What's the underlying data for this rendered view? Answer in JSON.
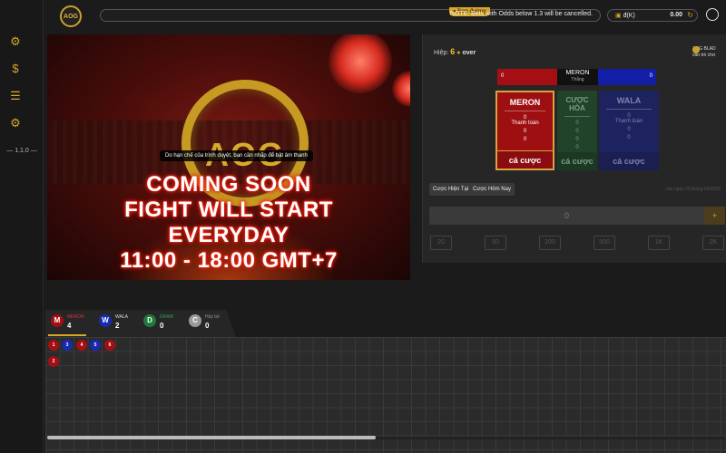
{
  "app": {
    "logo": "AOG",
    "version": "1.1.0"
  },
  "sidebar": {
    "icons": [
      "document-gear-icon",
      "document-money-icon",
      "document-list-icon",
      "gear-icon"
    ]
  },
  "topbar": {
    "pin_label": "Đơn đường",
    "notice": "NOTE: Bets with Odds below 1.3 will be cancelled."
  },
  "balance": {
    "label": "đ(K)",
    "value": "0.00"
  },
  "video": {
    "ring_text": "AOG",
    "tip": "Do hạn chế của trình duyệt, bạn cần nhấp để bật âm thanh",
    "lines": [
      "COMING SOON",
      "FIGHT WILL START",
      "EVERYDAY",
      "11:00 - 18:00 GMT+7"
    ]
  },
  "bet": {
    "round_label": "Hiệp:",
    "round_number": "6",
    "round_status": "over",
    "promo_line1": "AOG BLAD",
    "promo_line2": "vào trò chơ",
    "odds": {
      "meron": "0",
      "center_title": "MERON",
      "center_sub": "Thắng",
      "wala": "0"
    },
    "meron": {
      "title": "MERON",
      "v1": "0",
      "payout": "Thanh toán",
      "v2": "0",
      "v3": "0",
      "button": "cá cược"
    },
    "draw": {
      "title": "CƯỢC HÒA",
      "v1": "0",
      "v2": "0",
      "v3": "0",
      "v4": "0",
      "button": "cá cược"
    },
    "wala": {
      "title": "WALA",
      "v1": "0",
      "payout": "Thanh toán",
      "v2": "0",
      "v3": "0",
      "button": "cá cược"
    },
    "tabs": [
      "Cược Hiện Tại",
      "Cược Hôm Nay"
    ],
    "date": "vào ngày 20 tháng 05/2025",
    "amount": "0",
    "amount_btn": "+",
    "chips": [
      "20",
      "50",
      "100",
      "500",
      "1K",
      "2K"
    ]
  },
  "stats": [
    {
      "letter": "M",
      "name": "MERON",
      "count": "4",
      "color": "#a50f14",
      "name_color": "#e03030"
    },
    {
      "letter": "W",
      "name": "WALA",
      "count": "2",
      "color": "#1a2ab0",
      "name_color": "#dddddd"
    },
    {
      "letter": "D",
      "name": "DRAW",
      "count": "0",
      "color": "#1f7a3a",
      "name_color": "#2fa050"
    },
    {
      "letter": "C",
      "name": "Hủy bỏ",
      "count": "0",
      "color": "#9a9a9a",
      "name_color": "#999999"
    }
  ],
  "roadmap": [
    {
      "n": "1",
      "side": "m"
    },
    {
      "n": "3",
      "side": "w"
    },
    {
      "n": "4",
      "side": "m"
    },
    {
      "n": "5",
      "side": "w"
    },
    {
      "n": "6",
      "side": "m"
    },
    {
      "n": "2",
      "side": "m"
    }
  ]
}
